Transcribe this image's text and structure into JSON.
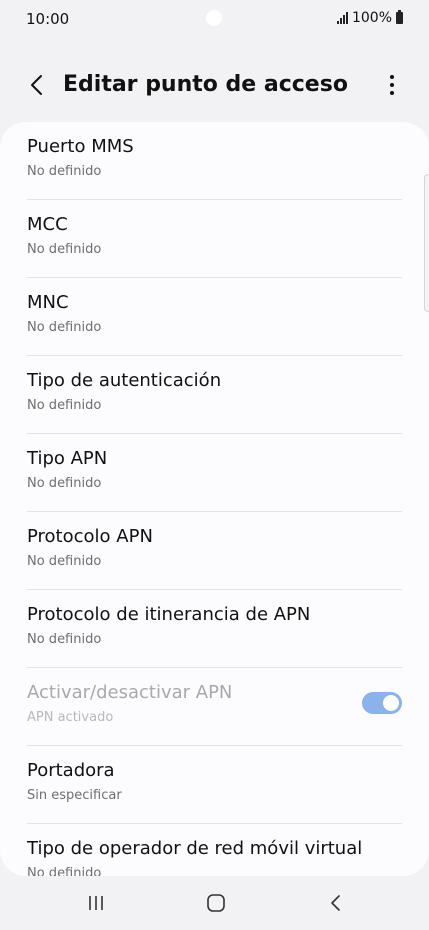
{
  "status": {
    "time": "10:00",
    "battery": "100%"
  },
  "appbar": {
    "title": "Editar punto de acceso"
  },
  "items": [
    {
      "label": "Puerto MMS",
      "value": "No definido"
    },
    {
      "label": "MCC",
      "value": "No definido"
    },
    {
      "label": "MNC",
      "value": "No definido"
    },
    {
      "label": "Tipo de autenticación",
      "value": "No definido"
    },
    {
      "label": "Tipo APN",
      "value": "No definido"
    },
    {
      "label": "Protocolo APN",
      "value": "No definido"
    },
    {
      "label": "Protocolo de itinerancia de APN",
      "value": "No definido"
    },
    {
      "label": "Activar/desactivar APN",
      "value": "APN activado",
      "toggle_on": true
    },
    {
      "label": "Portadora",
      "value": "Sin especificar"
    },
    {
      "label": "Tipo de operador de red móvil virtual",
      "value": "No definido"
    }
  ],
  "icons": {
    "back": "chevron-left-icon",
    "more": "more-vertical-icon",
    "recent": "recent-apps-icon",
    "home": "home-icon",
    "nav_back": "back-icon"
  },
  "colors": {
    "toggle": "#8bb2ea",
    "background": "#f2f2f4",
    "card": "#fcfcfe"
  }
}
